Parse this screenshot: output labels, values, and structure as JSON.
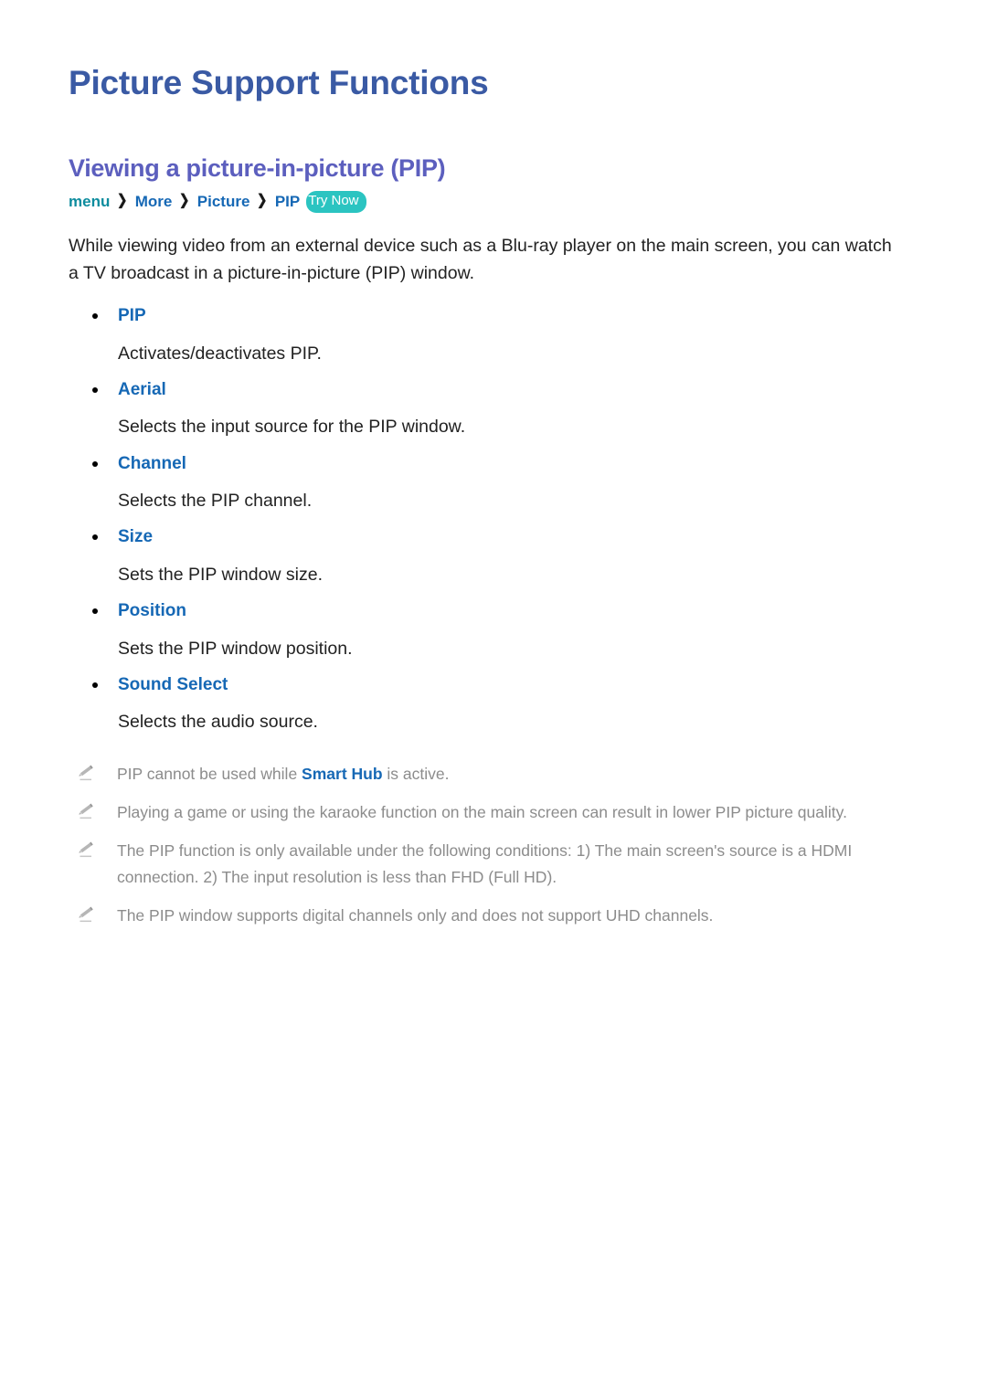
{
  "document": {
    "title": "Picture Support Functions",
    "section_heading": "Viewing a picture-in-picture (PIP)"
  },
  "breadcrumb": {
    "separator": "❯",
    "items": [
      {
        "label": "menu",
        "style": "menu"
      },
      {
        "label": "More",
        "style": "link"
      },
      {
        "label": "Picture",
        "style": "link"
      },
      {
        "label": "PIP",
        "style": "link"
      }
    ],
    "badge": "Try Now"
  },
  "intro": "While viewing video from an external device such as a Blu-ray player on the main screen, you can watch a TV broadcast in a picture-in-picture (PIP) window.",
  "options": [
    {
      "term": "PIP",
      "description": "Activates/deactivates PIP."
    },
    {
      "term": "Aerial",
      "description": "Selects the input source for the PIP window."
    },
    {
      "term": "Channel",
      "description": "Selects the PIP channel."
    },
    {
      "term": "Size",
      "description": "Sets the PIP window size."
    },
    {
      "term": "Position",
      "description": "Sets the PIP window position."
    },
    {
      "term": "Sound Select",
      "description": "Selects the audio source."
    }
  ],
  "notes": [
    {
      "icon": "pencil-icon",
      "before": "PIP cannot be used while ",
      "highlight": "Smart Hub",
      "after": " is active."
    },
    {
      "icon": "pencil-icon",
      "before": "Playing a game or using the karaoke function on the main screen can result in lower PIP picture quality.",
      "highlight": "",
      "after": ""
    },
    {
      "icon": "pencil-icon",
      "before": "The PIP function is only available under the following conditions: 1) The main screen's source is a HDMI connection. 2) The input resolution is less than FHD (Full HD).",
      "highlight": "",
      "after": ""
    },
    {
      "icon": "pencil-icon",
      "before": "The PIP window supports digital channels only and does not support UHD channels.",
      "highlight": "",
      "after": ""
    }
  ],
  "colors": {
    "page_title": "#3a5aa4",
    "section_heading": "#5c5fbe",
    "link_blue": "#1668b5",
    "menu_teal": "#0d8c9e",
    "badge_teal": "#2bc4c1",
    "body_text": "#222222",
    "note_text": "#8c8c8c"
  }
}
